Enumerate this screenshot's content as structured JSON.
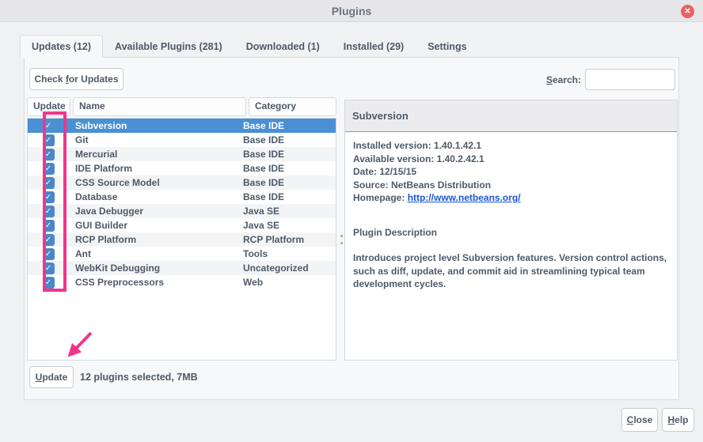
{
  "window": {
    "title": "Plugins"
  },
  "icons": {
    "close": "✕",
    "check": "✓"
  },
  "colors": {
    "accent": "#4a90d4",
    "checkbox": "#4a87c9",
    "link": "#1a56d6",
    "annotation": "#f0368c",
    "text": "#4e5a68"
  },
  "tabs": [
    {
      "label": "Updates (12)",
      "active": true
    },
    {
      "label": "Available Plugins (281)",
      "active": false
    },
    {
      "label": "Downloaded (1)",
      "active": false
    },
    {
      "label": "Installed (29)",
      "active": false
    },
    {
      "label": "Settings",
      "active": false
    }
  ],
  "toolbar": {
    "check_button": {
      "pre": "Check ",
      "mn": "f",
      "post": "or Updates"
    },
    "search_label": {
      "mn": "S",
      "post": "earch:"
    },
    "search_value": ""
  },
  "table": {
    "columns": [
      "Update",
      "Name",
      "Category"
    ],
    "rows": [
      {
        "name": "Subversion",
        "category": "Base IDE",
        "checked": true,
        "selected": true
      },
      {
        "name": "Git",
        "category": "Base IDE",
        "checked": true,
        "selected": false
      },
      {
        "name": "Mercurial",
        "category": "Base IDE",
        "checked": true,
        "selected": false
      },
      {
        "name": "IDE Platform",
        "category": "Base IDE",
        "checked": true,
        "selected": false
      },
      {
        "name": "CSS Source Model",
        "category": "Base IDE",
        "checked": true,
        "selected": false
      },
      {
        "name": "Database",
        "category": "Base IDE",
        "checked": true,
        "selected": false
      },
      {
        "name": "Java Debugger",
        "category": "Java SE",
        "checked": true,
        "selected": false
      },
      {
        "name": "GUI Builder",
        "category": "Java SE",
        "checked": true,
        "selected": false
      },
      {
        "name": "RCP Platform",
        "category": "RCP Platform",
        "checked": true,
        "selected": false
      },
      {
        "name": "Ant",
        "category": "Tools",
        "checked": true,
        "selected": false
      },
      {
        "name": "WebKit Debugging",
        "category": "Uncategorized",
        "checked": true,
        "selected": false
      },
      {
        "name": "CSS Preprocessors",
        "category": "Web",
        "checked": true,
        "selected": false
      }
    ]
  },
  "details": {
    "title": "Subversion",
    "fields": [
      {
        "label": "Installed version: ",
        "value": "1.40.1.42.1"
      },
      {
        "label": "Available version: ",
        "value": "1.40.2.42.1"
      },
      {
        "label": "Date: ",
        "value": "12/15/15"
      },
      {
        "label": "Source: ",
        "value": "NetBeans Distribution"
      }
    ],
    "homepage_label": "Homepage: ",
    "homepage_url": "http://www.netbeans.org/",
    "description_title": "Plugin Description",
    "description": "Introduces project level Subversion features. Version control actions, such as diff, update, and commit aid in streamlining typical team development cycles."
  },
  "footer": {
    "update_button": {
      "mn": "U",
      "post": "pdate"
    },
    "status": "12 plugins selected, 7MB"
  },
  "dialog_buttons": {
    "close": {
      "mn": "C",
      "post": "lose"
    },
    "help": {
      "mn": "H",
      "post": "elp"
    }
  }
}
